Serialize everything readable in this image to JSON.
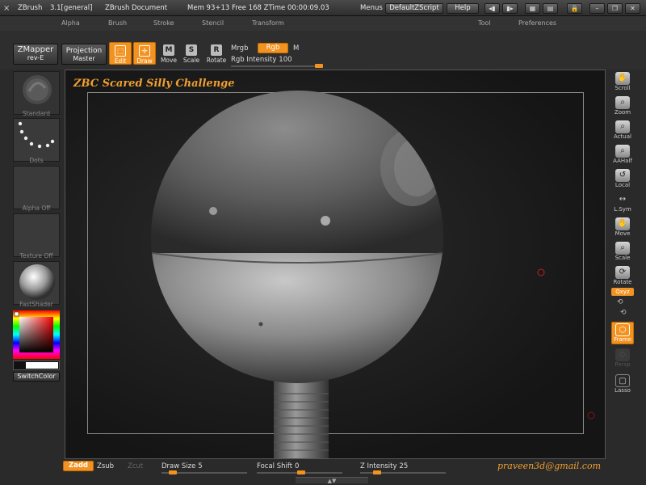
{
  "titlebar": {
    "app": "ZBrush",
    "version": "3.1[general]",
    "document": "ZBrush Document",
    "mem": "Mem 93+13 Free 168 ZTime 00:00:09.03",
    "menus_label": "Menus",
    "script_label": "DefaultZScript",
    "help_label": "Help"
  },
  "menubar": {
    "items": [
      "Alpha",
      "Brush",
      "Stroke",
      "Stencil",
      "Transform",
      "Tool",
      "Preferences"
    ]
  },
  "toolbar": {
    "zmapper_label": "ZMapper",
    "zmapper_sub": "rev-E",
    "projection_label": "Projection",
    "projection_sub": "Master",
    "edit_label": "Edit",
    "draw_label": "Draw",
    "move_label": "Move",
    "scale_label": "Scale",
    "rotate_label": "Rotate",
    "mrgb_label": "Mrgb",
    "rgb_label": "Rgb",
    "m_label": "M",
    "rgb_intensity_label": "Rgb Intensity",
    "rgb_intensity_value": "100",
    "rgb_intensity_pct": 100
  },
  "leftshelf": {
    "standard_label": "Standard",
    "dots_label": "Dots",
    "alpha_label": "Alpha Off",
    "texture_label": "Texture Off",
    "material_label": "FastShader",
    "switch_color_label": "SwitchColor"
  },
  "rightshelf": {
    "items": [
      "Scroll",
      "Zoom",
      "Actual",
      "AAHalf",
      "Local",
      "L.Sym",
      "Move",
      "Scale",
      "Rotate",
      "Frame",
      "Persp",
      "Lasso"
    ],
    "xyz_label": "Qxyz"
  },
  "canvas": {
    "title": "ZBC Scared Silly Challenge"
  },
  "bottombar": {
    "zadd_label": "Zadd",
    "zsub_label": "Zsub",
    "zcut_label": "Zcut",
    "draw_size_label": "Draw Size",
    "draw_size_value": "5",
    "focal_shift_label": "Focal Shift",
    "focal_shift_value": "0",
    "z_intensity_label": "Z Intensity",
    "z_intensity_value": "25",
    "email": "praveen3d@gmail.com"
  },
  "colors": {
    "accent": "#f29221",
    "brand_text": "#f0a030"
  }
}
